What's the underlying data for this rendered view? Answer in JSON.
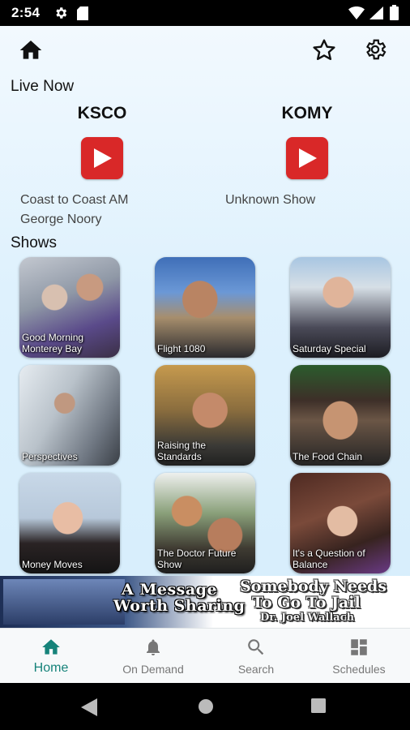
{
  "status": {
    "time": "2:54"
  },
  "icons": {
    "status_gear": "gear-icon",
    "status_sd": "sd-card-icon",
    "wifi": "wifi-icon",
    "signal": "signal-icon",
    "battery": "battery-icon",
    "home": "home-icon",
    "favorites": "star-outline-icon",
    "settings": "gear-icon",
    "play": "play-icon"
  },
  "live": {
    "title": "Live Now",
    "stations": [
      {
        "name": "KSCO",
        "show_lines": [
          "Coast to Coast AM",
          "George Noory"
        ]
      },
      {
        "name": "KOMY",
        "show_lines": [
          "Unknown Show"
        ]
      }
    ]
  },
  "shows": {
    "title": "Shows",
    "items": [
      {
        "label": "Good Morning Monterey Bay"
      },
      {
        "label": "Flight 1080"
      },
      {
        "label": "Saturday Special"
      },
      {
        "label": "Perspectives"
      },
      {
        "label": "Raising the Standards"
      },
      {
        "label": "The Food Chain"
      },
      {
        "label": "Money Moves"
      },
      {
        "label": "The Doctor Future Show"
      },
      {
        "label": "It's a Question of Balance"
      }
    ]
  },
  "ad": {
    "line1": "A Message",
    "line2": "Worth Sharing",
    "right1": "Somebody Needs",
    "right2": "To Go To Jail",
    "signature": "Dr. Joel Wallach"
  },
  "nav": {
    "items": [
      {
        "label": "Home",
        "icon": "home-icon",
        "active": true
      },
      {
        "label": "On Demand",
        "icon": "bell-icon",
        "active": false
      },
      {
        "label": "Search",
        "icon": "search-icon",
        "active": false
      },
      {
        "label": "Schedules",
        "icon": "dashboard-icon",
        "active": false
      }
    ]
  },
  "colors": {
    "accent": "#16837a",
    "play_red": "#d92828"
  }
}
